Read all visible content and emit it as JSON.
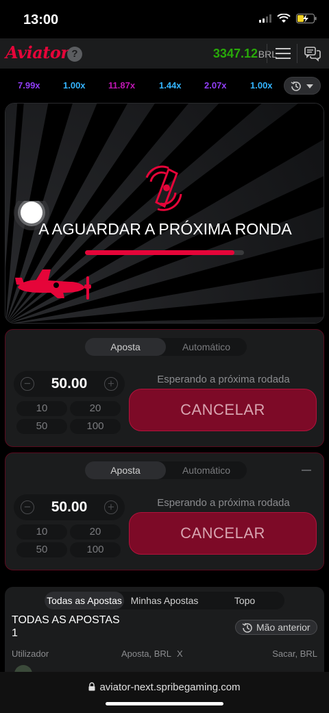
{
  "status_bar": {
    "time": "13:00"
  },
  "header": {
    "logo": "Aviator",
    "help_label": "?",
    "balance": "3347.12",
    "currency": "BRL"
  },
  "multipliers": [
    {
      "value": "7.99x",
      "color": "#913ef8"
    },
    {
      "value": "1.00x",
      "color": "#34b4ff"
    },
    {
      "value": "11.87x",
      "color": "#c017b4"
    },
    {
      "value": "1.44x",
      "color": "#34b4ff"
    },
    {
      "value": "2.07x",
      "color": "#913ef8"
    },
    {
      "value": "1.00x",
      "color": "#34b4ff"
    }
  ],
  "game": {
    "waiting_text": "A AGUARDAR A PRÓXIMA RONDA",
    "progress": 0.94,
    "accent": "#e50539"
  },
  "bet_panels": [
    {
      "tab_bet": "Aposta",
      "tab_auto": "Automático",
      "amount": "50.00",
      "quick": [
        "10",
        "20",
        "50",
        "100"
      ],
      "status": "Esperando a próxima rodada",
      "cancel": "CANCELAR"
    },
    {
      "tab_bet": "Aposta",
      "tab_auto": "Automático",
      "amount": "50.00",
      "quick": [
        "10",
        "20",
        "50",
        "100"
      ],
      "status": "Esperando a próxima rodada",
      "cancel": "CANCELAR"
    }
  ],
  "bets": {
    "tabs": [
      "Todas as Apostas",
      "Minhas Apostas",
      "Topo"
    ],
    "title": "TODAS AS APOSTAS",
    "count": "1",
    "previous_button": "Mão anterior",
    "columns": [
      "Utilizador",
      "Aposta, BRL",
      "X",
      "Sacar, BRL"
    ]
  },
  "browser": {
    "url": "aviator-next.spribegaming.com"
  }
}
